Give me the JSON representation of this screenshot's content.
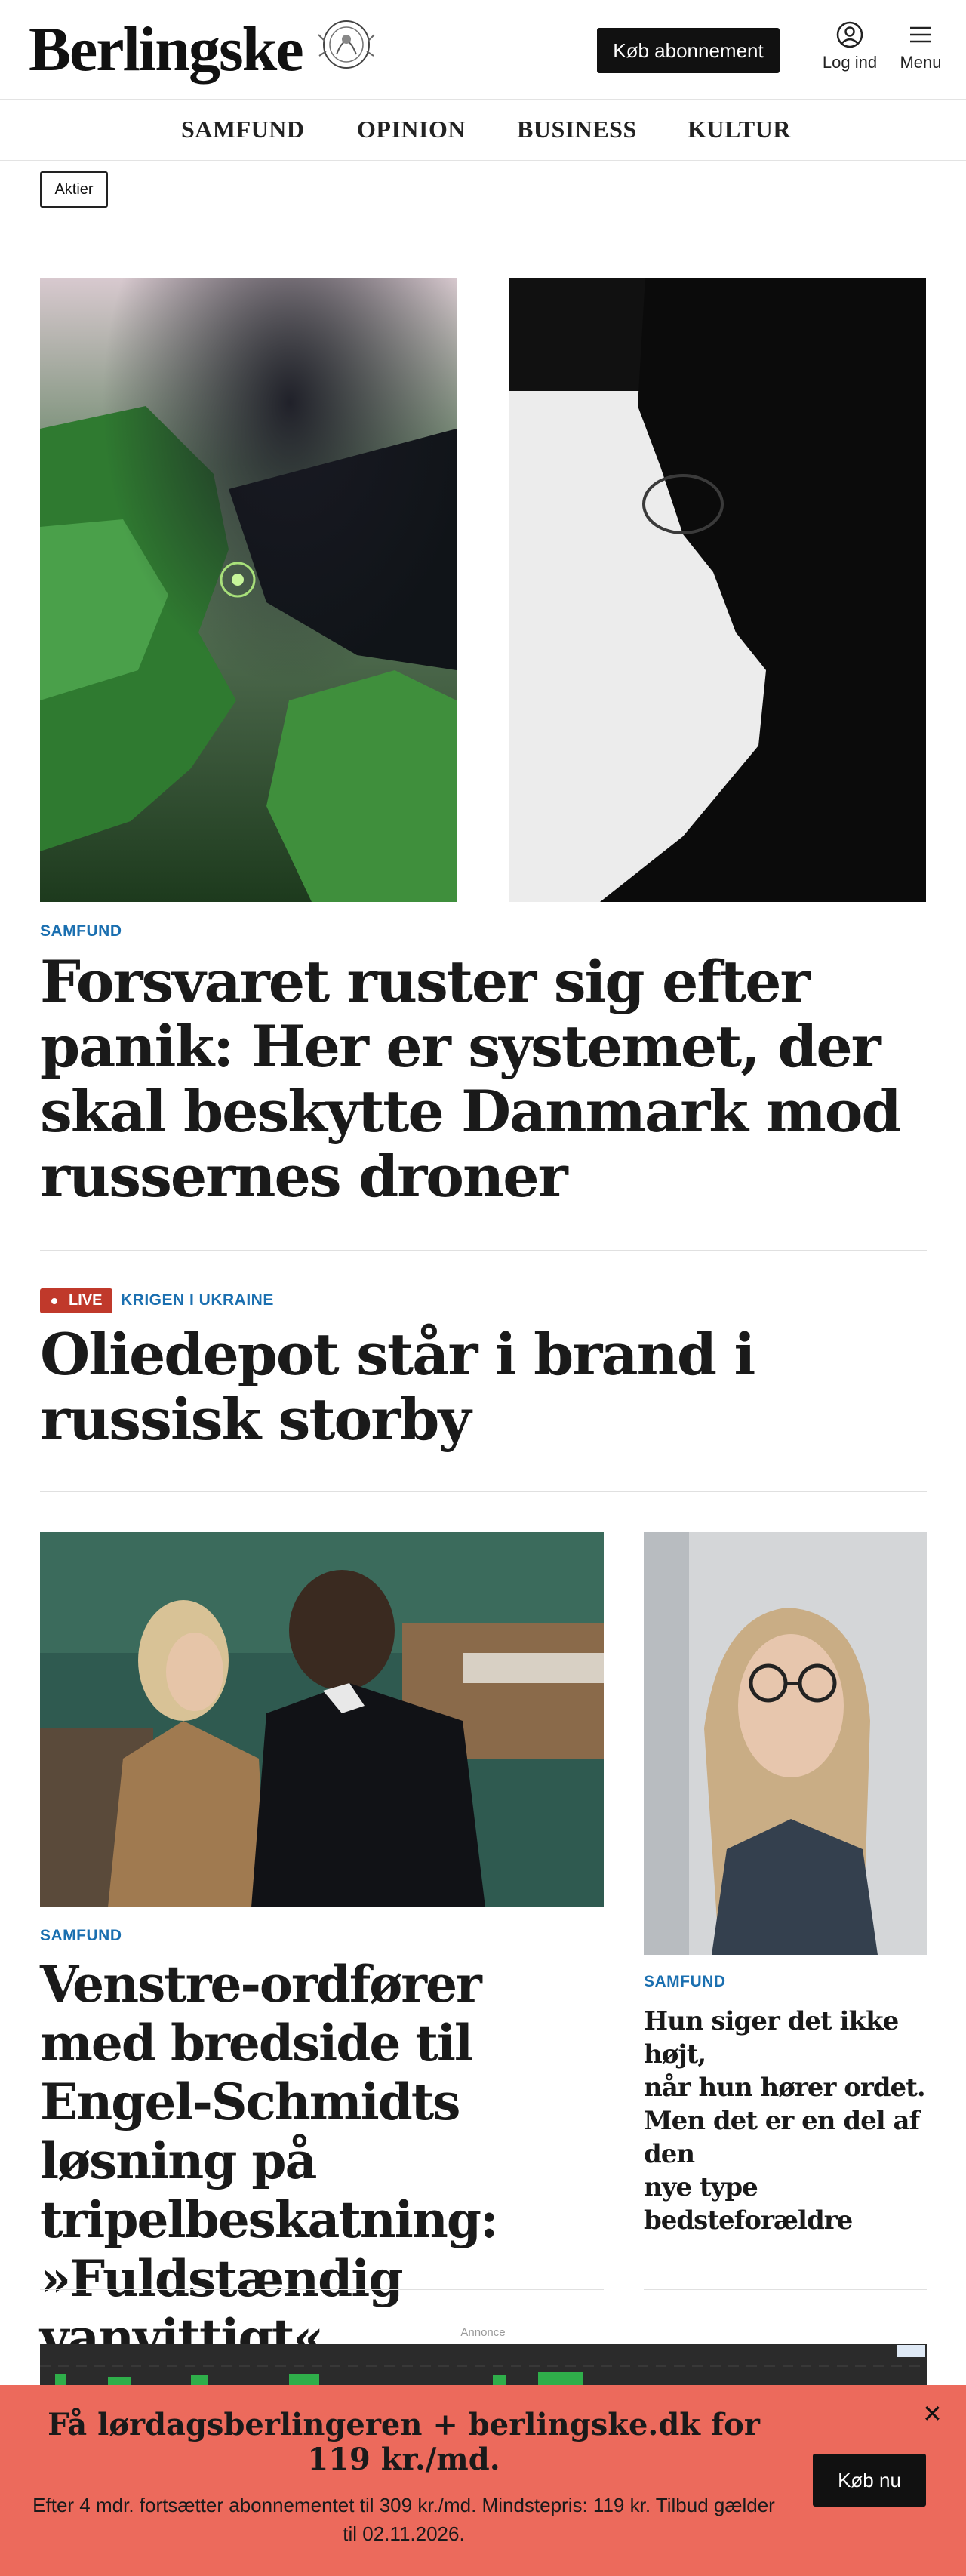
{
  "header": {
    "logo": "Berlingske",
    "subscribe_label": "Køb abonnement",
    "login_label": "Log ind",
    "menu_label": "Menu"
  },
  "nav": {
    "items": [
      "SAMFUND",
      "OPINION",
      "BUSINESS",
      "KULTUR"
    ]
  },
  "tag": "Aktier",
  "lead": {
    "kicker": "SAMFUND",
    "title": "Forsvaret ruster sig efter panik: Her er systemet, der skal beskytte Danmark mod russernes droner"
  },
  "live": {
    "badge": "LIVE",
    "kicker": "KRIGEN I UKRAINE",
    "title": "Oliedepot står i brand i russisk storby"
  },
  "story_main": {
    "kicker": "SAMFUND",
    "title": "Venstre-ordfører med bredside til Engel-Schmidts løsning på tripelbeskatning: »Fuldstændig vanvittigt«"
  },
  "story_side": {
    "kicker": "SAMFUND",
    "title_lines": [
      "Hun siger det ikke højt,",
      "når hun hører ordet.",
      "Men det er en del af den",
      "nye type",
      "bedsteforældre"
    ]
  },
  "ad": {
    "label": "Annonce"
  },
  "banner": {
    "title": "Få lørdagsberlingeren + berlingske.dk for 119 kr./md.",
    "subtitle": "Efter 4 mdr. fortsætter abonnementet til 309 kr./md. Mindstepris: 119 kr. Tilbud gælder til 02.11.2026.",
    "button": "Køb nu"
  },
  "colors": {
    "accent": "#1a6fb0",
    "live": "#c0392b",
    "banner": "#ec6a5c"
  }
}
